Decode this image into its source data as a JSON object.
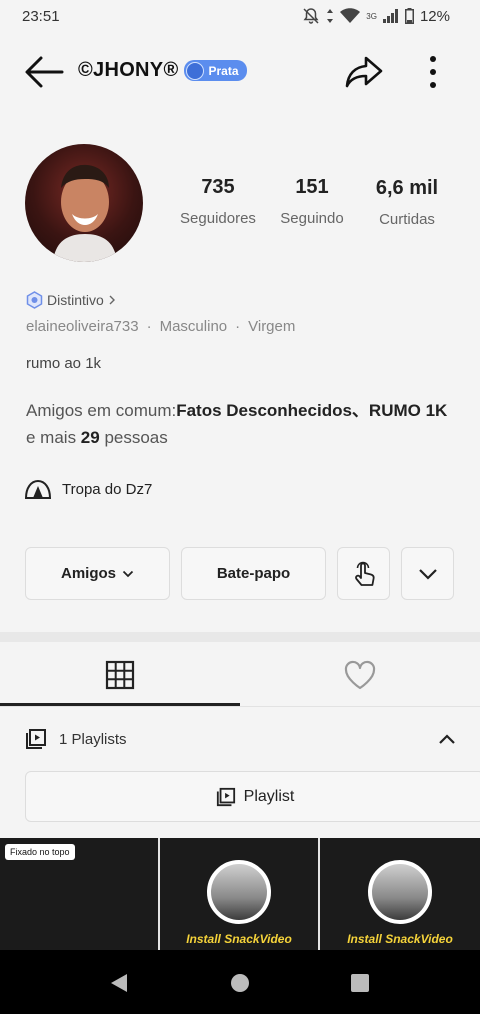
{
  "status_bar": {
    "time": "23:51",
    "network": "3G",
    "battery": "12%"
  },
  "header": {
    "title": "©JHONY®",
    "badge": "Prata"
  },
  "stats": [
    {
      "value": "735",
      "label": "Seguidores"
    },
    {
      "value": "151",
      "label": "Seguindo"
    },
    {
      "value": "6,6 mil",
      "label": "Curtidas"
    }
  ],
  "profile": {
    "distintivo": "Distintivo",
    "username": "elaineoliveira733",
    "gender": "Masculino",
    "sign": "Virgem",
    "bio": "rumo ao 1k",
    "mutual_prefix": "Amigos em comum:",
    "mutual_names": "Fatos Desconhecidos、RUMO 1K",
    "mutual_and": " e mais ",
    "mutual_count": "29",
    "mutual_suffix": " pessoas",
    "group": "Tropa do Dz7"
  },
  "actions": {
    "friends": "Amigos",
    "chat": "Bate-papo"
  },
  "tabs": {
    "grid_icon": "grid-icon",
    "likes_icon": "heart-icon"
  },
  "playlists": {
    "count_label": "1 Playlists",
    "button_label": "Playlist"
  },
  "videos": {
    "pinned_label": "Fixado no topo",
    "ad_label": "Install SnackVideo"
  },
  "colors": {
    "badge": "#5b8dee",
    "ad_text": "#f5d33a",
    "accent_icon": "#6f8fe8"
  }
}
